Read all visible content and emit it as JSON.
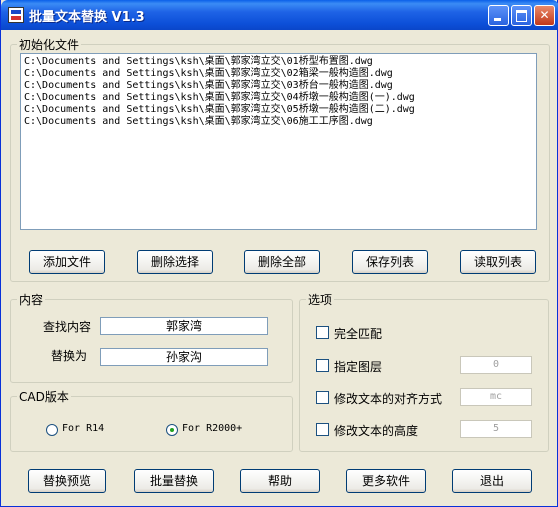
{
  "window": {
    "title": "批量文本替换 V1.3"
  },
  "files_group": {
    "legend": "初始化文件",
    "files": [
      "C:\\Documents and Settings\\ksh\\桌面\\郭家湾立交\\01桥型布置图.dwg",
      "C:\\Documents and Settings\\ksh\\桌面\\郭家湾立交\\02箱梁一般构造图.dwg",
      "C:\\Documents and Settings\\ksh\\桌面\\郭家湾立交\\03桥台一般构造图.dwg",
      "C:\\Documents and Settings\\ksh\\桌面\\郭家湾立交\\04桥墩一般构造图(一).dwg",
      "C:\\Documents and Settings\\ksh\\桌面\\郭家湾立交\\05桥墩一般构造图(二).dwg",
      "C:\\Documents and Settings\\ksh\\桌面\\郭家湾立交\\06施工工序图.dwg"
    ],
    "buttons": {
      "add": "添加文件",
      "delete_selected": "删除选择",
      "delete_all": "删除全部",
      "save_list": "保存列表",
      "load_list": "读取列表"
    }
  },
  "content_group": {
    "legend": "内容",
    "find_label": "查找内容",
    "find_value": "郭家湾",
    "replace_label": "替换为",
    "replace_value": "孙家沟"
  },
  "cad_group": {
    "legend": "CAD版本",
    "option_r14": "For R14",
    "option_r2000": "For R2000+",
    "selected": "For R2000+"
  },
  "options_group": {
    "legend": "选项",
    "full_match": "完全匹配",
    "layer": "指定图层",
    "layer_value": "0",
    "alignment": "修改文本的对齐方式",
    "alignment_value": "mc",
    "height": "修改文本的高度",
    "height_value": "5"
  },
  "bottom_buttons": {
    "preview": "替换预览",
    "batch": "批量替换",
    "help": "帮助",
    "more": "更多软件",
    "exit": "退出"
  }
}
